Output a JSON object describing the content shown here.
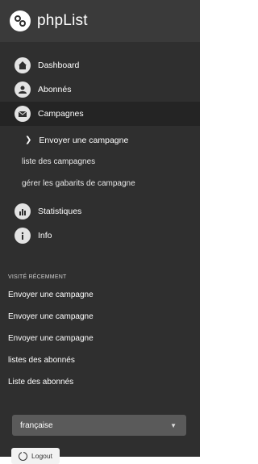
{
  "brand": {
    "name": "phpList"
  },
  "menu": [
    {
      "label": "Dashboard",
      "icon": "home-icon"
    },
    {
      "label": "Abonnés",
      "icon": "user-icon"
    },
    {
      "label": "Campagnes",
      "icon": "envelope-icon",
      "active": true
    }
  ],
  "campaign_submenu": [
    {
      "label": "Envoyer une campagne",
      "icon": "chevron-right-icon"
    },
    {
      "label": "liste des campagnes"
    },
    {
      "label": "gérer les gabarits de campagne"
    }
  ],
  "menu2": [
    {
      "label": "Statistiques",
      "icon": "chart-icon"
    },
    {
      "label": "Info",
      "icon": "info-icon"
    }
  ],
  "recent": {
    "title": "VISITÉ RÉCEMMENT",
    "items": [
      "Envoyer une campagne",
      "Envoyer une campagne",
      "Envoyer une campagne",
      "listes des abonnés",
      "Liste des abonnés"
    ]
  },
  "language_select": {
    "value": "française"
  },
  "logout": {
    "label": "Logout"
  },
  "colors": {
    "sidebar": "#2f2f2f",
    "active": "#242424",
    "select": "#5a5a5a"
  }
}
